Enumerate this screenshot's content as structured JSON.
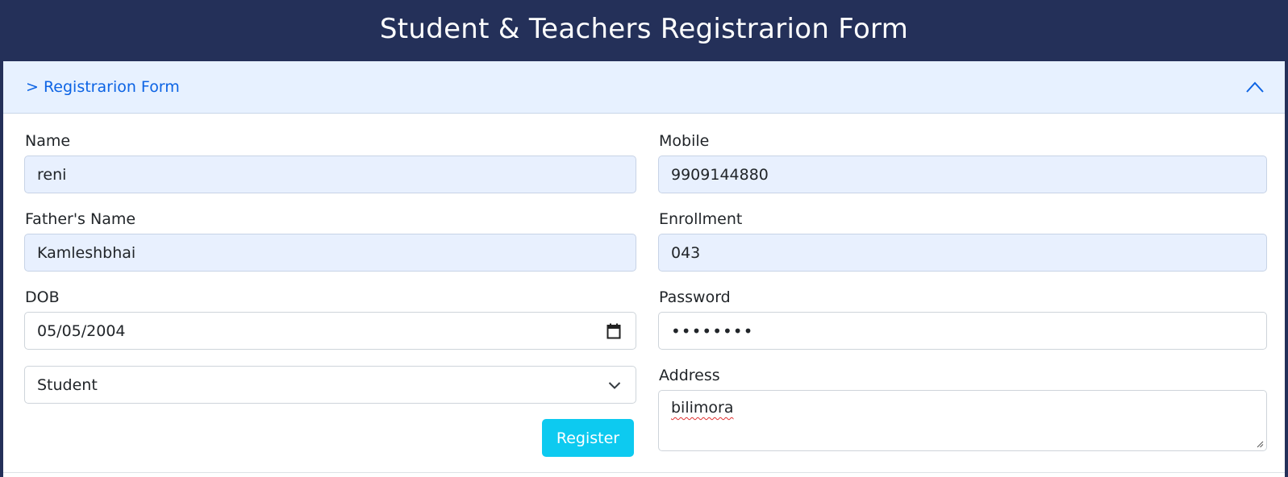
{
  "header": {
    "title": "Student & Teachers Registrarion Form"
  },
  "accordion": {
    "title": "> Registrarion Form",
    "icon": "chevron-up-icon"
  },
  "form": {
    "name": {
      "label": "Name",
      "value": "reni"
    },
    "father_name": {
      "label": "Father's Name",
      "value": "Kamleshbhai"
    },
    "dob": {
      "label": "DOB",
      "value": "05/05/2004",
      "icon": "calendar-icon"
    },
    "role": {
      "selected": "Student",
      "icon": "chevron-down-icon"
    },
    "mobile": {
      "label": "Mobile",
      "value": "9909144880"
    },
    "enrollment": {
      "label": "Enrollment",
      "value": "043"
    },
    "password": {
      "label": "Password",
      "value": "••••••••"
    },
    "address": {
      "label": "Address",
      "value": "bilimora"
    },
    "register_label": "Register"
  },
  "colors": {
    "header_bg": "#243059",
    "accordion_bg": "#e7f1ff",
    "accordion_text": "#0c63e4",
    "autofill_bg": "#e8f0fe",
    "button_bg": "#0dcaf0"
  }
}
